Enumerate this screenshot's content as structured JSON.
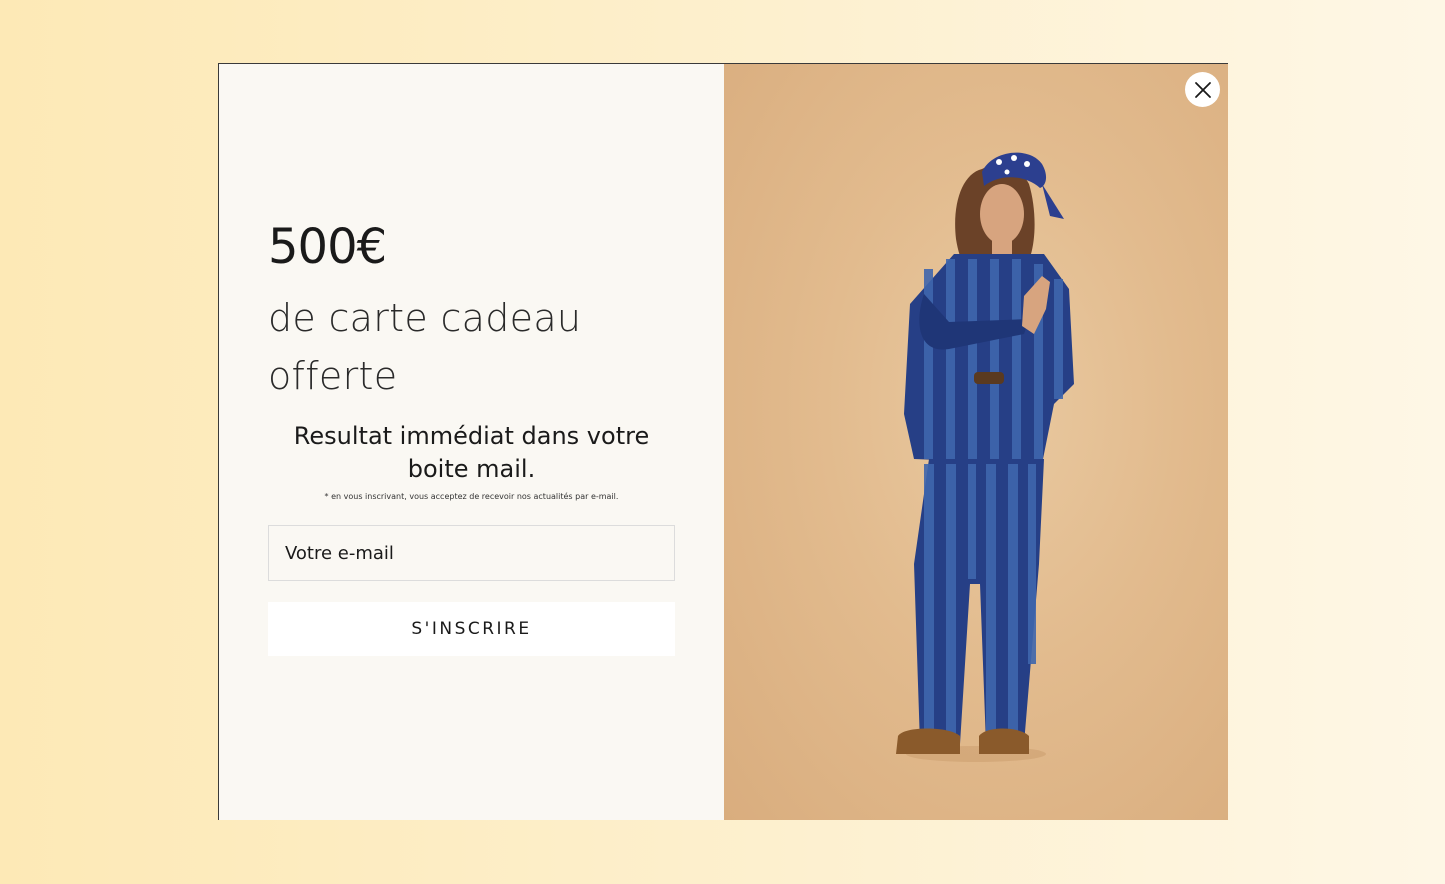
{
  "popup": {
    "amount": "500€",
    "subtitle": "de carte cadeau offerte",
    "result_text": "Resultat immédiat dans votre boite mail.",
    "disclaimer": "* en vous inscrivant, vous acceptez de recevoir nos actualités par e-mail.",
    "email_placeholder": "Votre e-mail",
    "email_value": "",
    "subscribe_label": "S'INSCRIRE",
    "close_icon": "close-icon",
    "image_description_icon": "model-photo"
  },
  "colors": {
    "panel_bg": "#faf8f3",
    "photo_bg": "#e2bb8e",
    "denim": "#23408a",
    "text": "#1a1a1a"
  }
}
